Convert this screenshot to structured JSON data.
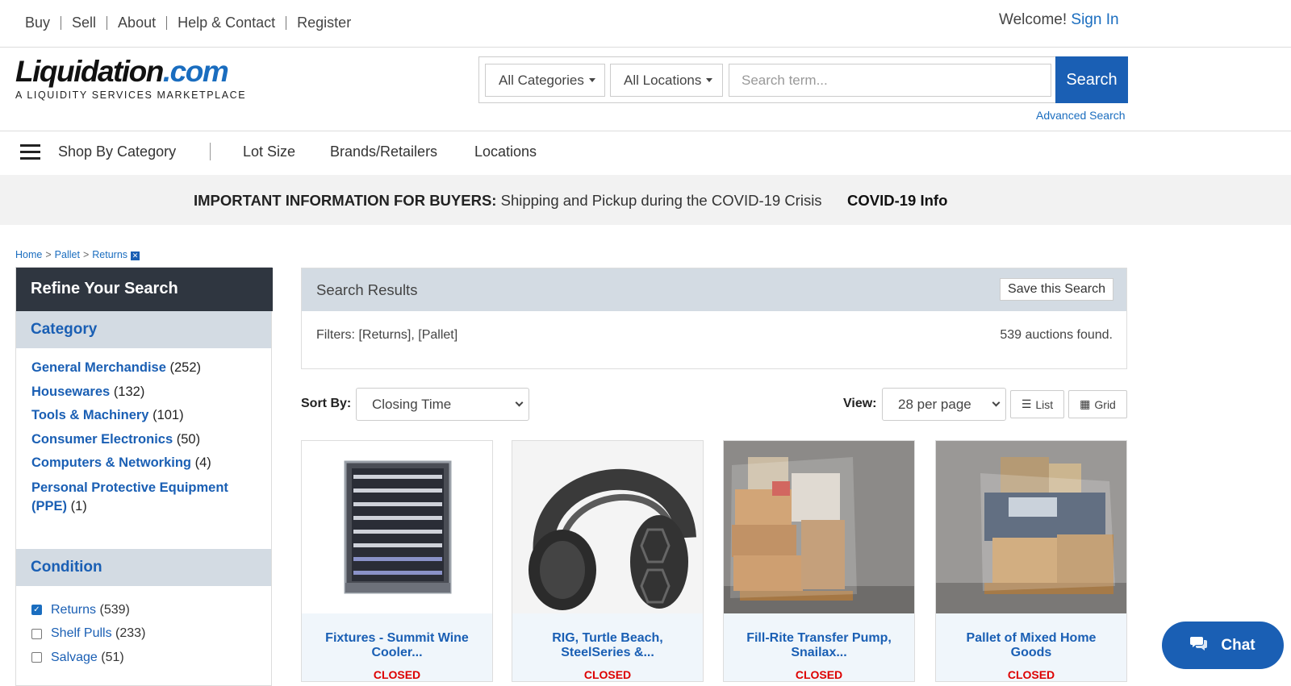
{
  "topnav": {
    "items": [
      "Buy",
      "Sell",
      "About",
      "Help & Contact",
      "Register"
    ],
    "welcome": "Welcome!",
    "signin": "Sign In"
  },
  "logo": {
    "brand_main": "Liquidation",
    "brand_suffix": ".com",
    "tagline": "A LIQUIDITY SERVICES MARKETPLACE"
  },
  "search": {
    "category_select": "All Categories",
    "location_select": "All Locations",
    "placeholder": "Search term...",
    "button": "Search",
    "advanced": "Advanced Search"
  },
  "catnav": {
    "shop": "Shop By Category",
    "items": [
      "Lot Size",
      "Brands/Retailers",
      "Locations"
    ]
  },
  "banner": {
    "bold": "IMPORTANT INFORMATION FOR BUYERS:",
    "text": "Shipping and Pickup during the COVID-19 Crisis",
    "link": "COVID-19 Info"
  },
  "breadcrumb": {
    "home": "Home",
    "pallet": "Pallet",
    "returns": "Returns",
    "remove": "✕"
  },
  "sidebar": {
    "title": "Refine Your Search",
    "category_heading": "Category",
    "categories": [
      {
        "name": "General Merchandise",
        "count": "(252)"
      },
      {
        "name": "Housewares",
        "count": "(132)"
      },
      {
        "name": "Tools & Machinery",
        "count": "(101)"
      },
      {
        "name": "Consumer Electronics",
        "count": "(50)"
      },
      {
        "name": "Computers & Networking",
        "count": "(4)"
      },
      {
        "name": "Personal Protective Equipment (PPE)",
        "count": "(1)"
      }
    ],
    "condition_heading": "Condition",
    "conditions": [
      {
        "name": "Returns",
        "count": "(539)",
        "checked": true
      },
      {
        "name": "Shelf Pulls",
        "count": "(233)",
        "checked": false
      },
      {
        "name": "Salvage",
        "count": "(51)",
        "checked": false
      }
    ]
  },
  "results": {
    "heading": "Search Results",
    "save": "Save this Search",
    "filters": "Filters: [Returns], [Pallet]",
    "found": "539 auctions found."
  },
  "sort": {
    "label": "Sort By:",
    "value": "Closing Time",
    "view_label": "View:",
    "per_page": "28 per page",
    "list": "List",
    "grid": "Grid"
  },
  "cards": [
    {
      "title": "Fixtures - Summit Wine Cooler...",
      "status": "CLOSED"
    },
    {
      "title": "RIG, Turtle Beach, SteelSeries &...",
      "status": "CLOSED"
    },
    {
      "title": "Fill-Rite Transfer Pump, Snailax...",
      "status": "CLOSED"
    },
    {
      "title": "Pallet of Mixed Home Goods",
      "status": "CLOSED"
    }
  ],
  "chat": {
    "label": "Chat"
  },
  "colors": {
    "accent": "#1a5fb4",
    "link": "#1a6dbf",
    "section_bg": "#d3dbe3",
    "dark_header": "#2f3640",
    "closed": "#dd0000"
  }
}
